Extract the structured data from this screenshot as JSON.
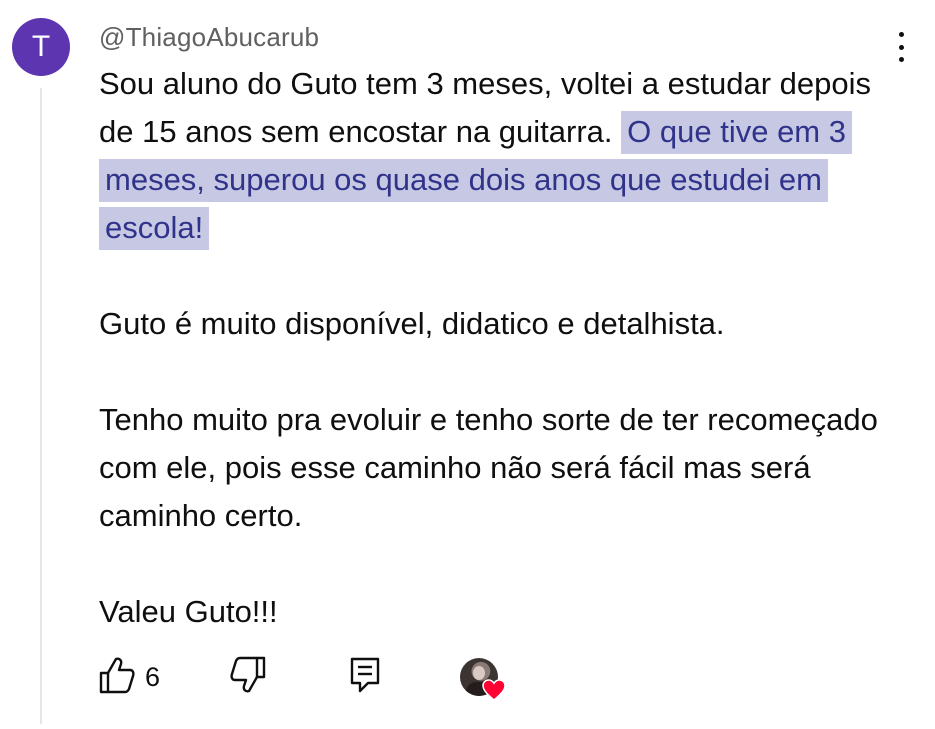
{
  "comment": {
    "avatar_letter": "T",
    "author_handle": "@ThiagoAbucarub",
    "paragraphs": [
      {
        "plain": "Sou aluno do Guto tem 3 meses, voltei a estudar depois de 15 anos sem encostar na guitarra. ",
        "highlighted": "O que tive em 3 meses, superou os quase dois anos que estudei em escola!"
      },
      {
        "plain": "Guto é muito disponível, didatico e detalhista."
      },
      {
        "plain": "Tenho muito pra evoluir e tenho sorte de ter recomeçado com ele, pois esse caminho não será fácil mas será caminho certo."
      },
      {
        "plain": "Valeu Guto!!!"
      }
    ]
  },
  "actions": {
    "like_count": "6"
  },
  "colors": {
    "avatar_bg": "#5e35b1",
    "highlight_bg": "#c6c8e4",
    "highlight_text": "#30338a",
    "heart": "#ff0033"
  },
  "icons": [
    "more-vert-icon",
    "thumb-up-icon",
    "thumb-down-icon",
    "reply-icon",
    "creator-heart-icon"
  ]
}
